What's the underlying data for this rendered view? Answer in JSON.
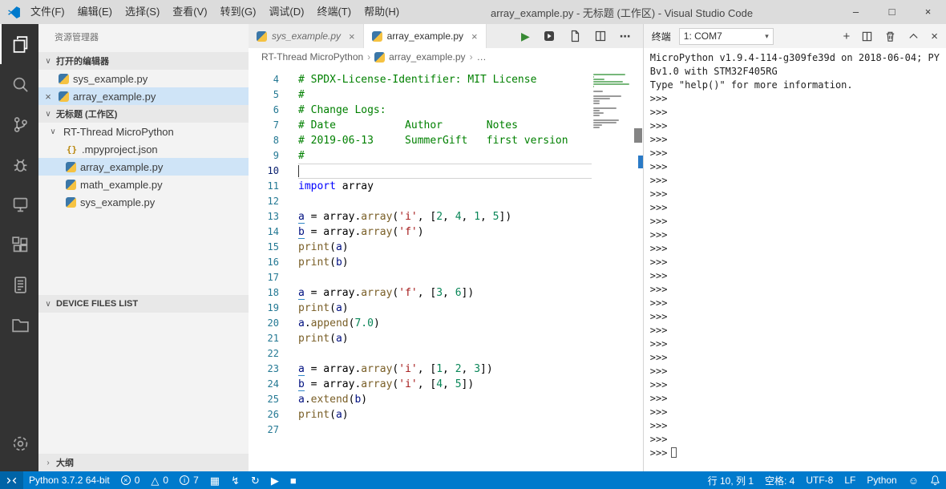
{
  "colors": {
    "accent": "#007acc",
    "titlebar_bg": "#dcdcdc",
    "activity_bar_bg": "#333333",
    "selection_bg": "#cfe4f7",
    "run_button_green": "#388a34"
  },
  "titlebar": {
    "menus": [
      "文件(F)",
      "编辑(E)",
      "选择(S)",
      "查看(V)",
      "转到(G)",
      "调试(D)",
      "终端(T)",
      "帮助(H)"
    ],
    "title": "array_example.py - 无标题 (工作区) - Visual Studio Code",
    "window_controls": {
      "minimize": "–",
      "maximize": "□",
      "close": "×"
    }
  },
  "activity_bar": {
    "items": [
      {
        "name": "explorer",
        "active": true
      },
      {
        "name": "search",
        "active": false
      },
      {
        "name": "source-control",
        "active": false
      },
      {
        "name": "debug",
        "active": false
      },
      {
        "name": "device",
        "active": false
      },
      {
        "name": "extensions",
        "active": false
      },
      {
        "name": "report",
        "active": false
      },
      {
        "name": "folder",
        "active": false
      }
    ],
    "bottom": [
      {
        "name": "settings",
        "active": false
      }
    ]
  },
  "sidebar": {
    "title": "资源管理器",
    "open_editors": {
      "header": "打开的编辑器",
      "items": [
        {
          "label": "sys_example.py",
          "icon": "python",
          "selected": false,
          "show_close": false
        },
        {
          "label": "array_example.py",
          "icon": "python",
          "selected": true,
          "show_close": true
        }
      ]
    },
    "workspace": {
      "header": "无标题 (工作区)",
      "folder": {
        "label": "RT-Thread MicroPython",
        "expanded": true
      },
      "files": [
        {
          "label": ".mpyproject.json",
          "icon": "json",
          "selected": false
        },
        {
          "label": "array_example.py",
          "icon": "python",
          "selected": true
        },
        {
          "label": "math_example.py",
          "icon": "python",
          "selected": false
        },
        {
          "label": "sys_example.py",
          "icon": "python",
          "selected": false
        }
      ]
    },
    "device_files": {
      "header": "DEVICE FILES LIST"
    },
    "outline": {
      "header": "大纲"
    }
  },
  "editor": {
    "tabs": [
      {
        "label": "sys_example.py",
        "icon": "python",
        "active": false,
        "preview": true
      },
      {
        "label": "array_example.py",
        "icon": "python",
        "active": true,
        "preview": false
      }
    ],
    "actions": [
      {
        "name": "run-file",
        "glyph": "▶"
      },
      {
        "name": "run-device",
        "glyph": ""
      },
      {
        "name": "open-file",
        "glyph": ""
      },
      {
        "name": "split-editor",
        "glyph": ""
      },
      {
        "name": "more-actions",
        "glyph": "⋯"
      }
    ],
    "breadcrumb": {
      "items": [
        "RT-Thread MicroPython",
        "array_example.py",
        "…"
      ]
    },
    "current_line": 10,
    "lines": [
      {
        "n": 4,
        "tokens": [
          {
            "t": "# SPDX-License-Identifier: MIT License",
            "c": "cm"
          }
        ]
      },
      {
        "n": 5,
        "tokens": [
          {
            "t": "#",
            "c": "cm"
          }
        ]
      },
      {
        "n": 6,
        "tokens": [
          {
            "t": "# Change Logs:",
            "c": "cm"
          }
        ]
      },
      {
        "n": 7,
        "tokens": [
          {
            "t": "# Date           Author       Notes",
            "c": "cm"
          }
        ]
      },
      {
        "n": 8,
        "tokens": [
          {
            "t": "# 2019-06-13     SummerGift   first version",
            "c": "cm"
          }
        ]
      },
      {
        "n": 9,
        "tokens": [
          {
            "t": "#",
            "c": "cm"
          }
        ]
      },
      {
        "n": 10,
        "tokens": []
      },
      {
        "n": 11,
        "tokens": [
          {
            "t": "import",
            "c": "kw"
          },
          {
            "t": " array",
            "c": "pl"
          }
        ]
      },
      {
        "n": 12,
        "tokens": []
      },
      {
        "n": 13,
        "tokens": [
          {
            "t": "a",
            "c": "var",
            "u": true
          },
          {
            "t": " = array.",
            "c": "pl"
          },
          {
            "t": "array",
            "c": "fn"
          },
          {
            "t": "(",
            "c": "pl"
          },
          {
            "t": "'i'",
            "c": "str"
          },
          {
            "t": ", [",
            "c": "pl"
          },
          {
            "t": "2",
            "c": "num"
          },
          {
            "t": ", ",
            "c": "pl"
          },
          {
            "t": "4",
            "c": "num"
          },
          {
            "t": ", ",
            "c": "pl"
          },
          {
            "t": "1",
            "c": "num"
          },
          {
            "t": ", ",
            "c": "pl"
          },
          {
            "t": "5",
            "c": "num"
          },
          {
            "t": "])",
            "c": "pl"
          }
        ]
      },
      {
        "n": 14,
        "tokens": [
          {
            "t": "b",
            "c": "var",
            "u": true
          },
          {
            "t": " = array.",
            "c": "pl"
          },
          {
            "t": "array",
            "c": "fn"
          },
          {
            "t": "(",
            "c": "pl"
          },
          {
            "t": "'f'",
            "c": "str"
          },
          {
            "t": ")",
            "c": "pl"
          }
        ]
      },
      {
        "n": 15,
        "tokens": [
          {
            "t": "print",
            "c": "fn"
          },
          {
            "t": "(",
            "c": "pl"
          },
          {
            "t": "a",
            "c": "var"
          },
          {
            "t": ")",
            "c": "pl"
          }
        ]
      },
      {
        "n": 16,
        "tokens": [
          {
            "t": "print",
            "c": "fn"
          },
          {
            "t": "(",
            "c": "pl"
          },
          {
            "t": "b",
            "c": "var"
          },
          {
            "t": ")",
            "c": "pl"
          }
        ]
      },
      {
        "n": 17,
        "tokens": []
      },
      {
        "n": 18,
        "tokens": [
          {
            "t": "a",
            "c": "var",
            "u": true
          },
          {
            "t": " = array.",
            "c": "pl"
          },
          {
            "t": "array",
            "c": "fn"
          },
          {
            "t": "(",
            "c": "pl"
          },
          {
            "t": "'f'",
            "c": "str"
          },
          {
            "t": ", [",
            "c": "pl"
          },
          {
            "t": "3",
            "c": "num"
          },
          {
            "t": ", ",
            "c": "pl"
          },
          {
            "t": "6",
            "c": "num"
          },
          {
            "t": "])",
            "c": "pl"
          }
        ]
      },
      {
        "n": 19,
        "tokens": [
          {
            "t": "print",
            "c": "fn"
          },
          {
            "t": "(",
            "c": "pl"
          },
          {
            "t": "a",
            "c": "var"
          },
          {
            "t": ")",
            "c": "pl"
          }
        ]
      },
      {
        "n": 20,
        "tokens": [
          {
            "t": "a",
            "c": "var"
          },
          {
            "t": ".",
            "c": "pl"
          },
          {
            "t": "append",
            "c": "fn"
          },
          {
            "t": "(",
            "c": "pl"
          },
          {
            "t": "7.0",
            "c": "num"
          },
          {
            "t": ")",
            "c": "pl"
          }
        ]
      },
      {
        "n": 21,
        "tokens": [
          {
            "t": "print",
            "c": "fn"
          },
          {
            "t": "(",
            "c": "pl"
          },
          {
            "t": "a",
            "c": "var"
          },
          {
            "t": ")",
            "c": "pl"
          }
        ]
      },
      {
        "n": 22,
        "tokens": []
      },
      {
        "n": 23,
        "tokens": [
          {
            "t": "a",
            "c": "var",
            "u": true
          },
          {
            "t": " = array.",
            "c": "pl"
          },
          {
            "t": "array",
            "c": "fn"
          },
          {
            "t": "(",
            "c": "pl"
          },
          {
            "t": "'i'",
            "c": "str"
          },
          {
            "t": ", [",
            "c": "pl"
          },
          {
            "t": "1",
            "c": "num"
          },
          {
            "t": ", ",
            "c": "pl"
          },
          {
            "t": "2",
            "c": "num"
          },
          {
            "t": ", ",
            "c": "pl"
          },
          {
            "t": "3",
            "c": "num"
          },
          {
            "t": "])",
            "c": "pl"
          }
        ]
      },
      {
        "n": 24,
        "tokens": [
          {
            "t": "b",
            "c": "var",
            "u": true
          },
          {
            "t": " = array.",
            "c": "pl"
          },
          {
            "t": "array",
            "c": "fn"
          },
          {
            "t": "(",
            "c": "pl"
          },
          {
            "t": "'i'",
            "c": "str"
          },
          {
            "t": ", [",
            "c": "pl"
          },
          {
            "t": "4",
            "c": "num"
          },
          {
            "t": ", ",
            "c": "pl"
          },
          {
            "t": "5",
            "c": "num"
          },
          {
            "t": "])",
            "c": "pl"
          }
        ]
      },
      {
        "n": 25,
        "tokens": [
          {
            "t": "a",
            "c": "var"
          },
          {
            "t": ".",
            "c": "pl"
          },
          {
            "t": "extend",
            "c": "fn"
          },
          {
            "t": "(",
            "c": "pl"
          },
          {
            "t": "b",
            "c": "var"
          },
          {
            "t": ")",
            "c": "pl"
          }
        ]
      },
      {
        "n": 26,
        "tokens": [
          {
            "t": "print",
            "c": "fn"
          },
          {
            "t": "(",
            "c": "pl"
          },
          {
            "t": "a",
            "c": "var"
          },
          {
            "t": ")",
            "c": "pl"
          }
        ]
      },
      {
        "n": 27,
        "tokens": []
      }
    ]
  },
  "terminal": {
    "title": "终端",
    "selector": "1: COM7",
    "actions": [
      {
        "name": "new-terminal",
        "glyph": "+"
      },
      {
        "name": "split-terminal",
        "glyph": ""
      },
      {
        "name": "kill-terminal",
        "glyph": ""
      },
      {
        "name": "maximize-panel",
        "glyph": ""
      },
      {
        "name": "close-panel",
        "glyph": "×"
      }
    ],
    "banner": [
      "MicroPython v1.9.4-114-g309fe39d on 2018-06-04; PY",
      "Bv1.0 with STM32F405RG",
      "Type \"help()\" for more information."
    ],
    "prompt": ">>>",
    "prompt_count": 27
  },
  "status_bar": {
    "left": [
      {
        "name": "remote-indicator",
        "icon": "remote",
        "text": ""
      },
      {
        "name": "python-interpreter",
        "icon": "",
        "text": "Python 3.7.2 64-bit"
      },
      {
        "name": "errors",
        "icon": "error",
        "text": "0"
      },
      {
        "name": "warnings",
        "icon": "warning",
        "text": "0"
      },
      {
        "name": "infos",
        "icon": "info",
        "text": "7"
      },
      {
        "name": "device-download",
        "icon": "grid",
        "text": ""
      },
      {
        "name": "device-flash",
        "icon": "bolt",
        "text": ""
      },
      {
        "name": "device-sync",
        "icon": "sync",
        "text": ""
      },
      {
        "name": "device-run",
        "icon": "play",
        "text": ""
      },
      {
        "name": "device-stop",
        "icon": "stop",
        "text": ""
      }
    ],
    "right": [
      {
        "name": "cursor-position",
        "icon": "",
        "text": "行 10, 列 1"
      },
      {
        "name": "indentation",
        "icon": "",
        "text": "空格: 4"
      },
      {
        "name": "encoding",
        "icon": "",
        "text": "UTF-8"
      },
      {
        "name": "eol",
        "icon": "",
        "text": "LF"
      },
      {
        "name": "language-mode",
        "icon": "",
        "text": "Python"
      },
      {
        "name": "feedback",
        "icon": "smiley",
        "text": ""
      },
      {
        "name": "notifications",
        "icon": "bell",
        "text": ""
      }
    ]
  }
}
